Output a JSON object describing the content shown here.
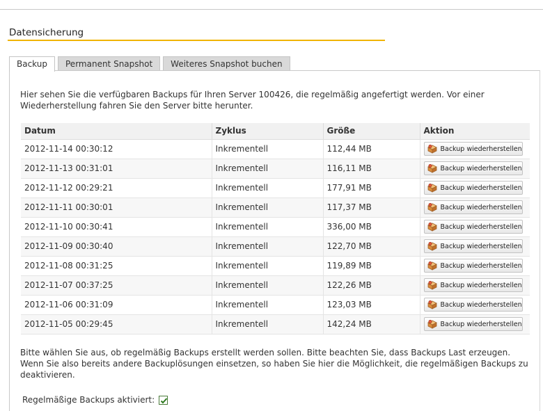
{
  "page": {
    "title": "Datensicherung",
    "accent_color": "#f0b400"
  },
  "tabs": [
    {
      "label": "Backup",
      "active": true
    },
    {
      "label": "Permanent Snapshot",
      "active": false
    },
    {
      "label": "Weiteres Snapshot buchen",
      "active": false
    }
  ],
  "intro_text": "Hier sehen Sie die verfügbaren Backups für Ihren Server 100426, die regelmäßig angefertigt werden. Vor einer Wiederherstellung fahren Sie den Server bitte herunter.",
  "table": {
    "headers": {
      "date": "Datum",
      "cycle": "Zyklus",
      "size": "Größe",
      "action": "Aktion"
    },
    "rows": [
      {
        "date": "2012-11-14 00:30:12",
        "cycle": "Inkrementell",
        "size": "112,44 MB",
        "action": "Backup wiederherstellen"
      },
      {
        "date": "2012-11-13 00:31:01",
        "cycle": "Inkrementell",
        "size": "116,11 MB",
        "action": "Backup wiederherstellen"
      },
      {
        "date": "2012-11-12 00:29:21",
        "cycle": "Inkrementell",
        "size": "177,91 MB",
        "action": "Backup wiederherstellen"
      },
      {
        "date": "2012-11-11 00:30:01",
        "cycle": "Inkrementell",
        "size": "117,37 MB",
        "action": "Backup wiederherstellen"
      },
      {
        "date": "2012-11-10 00:30:41",
        "cycle": "Inkrementell",
        "size": "336,00 MB",
        "action": "Backup wiederherstellen"
      },
      {
        "date": "2012-11-09 00:30:40",
        "cycle": "Inkrementell",
        "size": "122,70 MB",
        "action": "Backup wiederherstellen"
      },
      {
        "date": "2012-11-08 00:31:25",
        "cycle": "Inkrementell",
        "size": "119,89 MB",
        "action": "Backup wiederherstellen"
      },
      {
        "date": "2012-11-07 00:37:25",
        "cycle": "Inkrementell",
        "size": "122,26 MB",
        "action": "Backup wiederherstellen"
      },
      {
        "date": "2012-11-06 00:31:09",
        "cycle": "Inkrementell",
        "size": "123,03 MB",
        "action": "Backup wiederherstellen"
      },
      {
        "date": "2012-11-05 00:29:45",
        "cycle": "Inkrementell",
        "size": "142,24 MB",
        "action": "Backup wiederherstellen"
      }
    ]
  },
  "note_text": "Bitte wählen Sie aus, ob regelmäßig Backups erstellt werden sollen. Bitte beachten Sie, dass Backups Last erzeugen. Wenn Sie also bereits andere Backuplösungen einsetzen, so haben Sie hier die Möglichkeit, die regelmäßigen Backups zu deaktivieren.",
  "auto_backup": {
    "label": "Regelmäßige Backups aktiviert:",
    "checked": true
  },
  "icons": {
    "restore": "restore-box-icon",
    "checkbox": "checkmark-icon"
  }
}
